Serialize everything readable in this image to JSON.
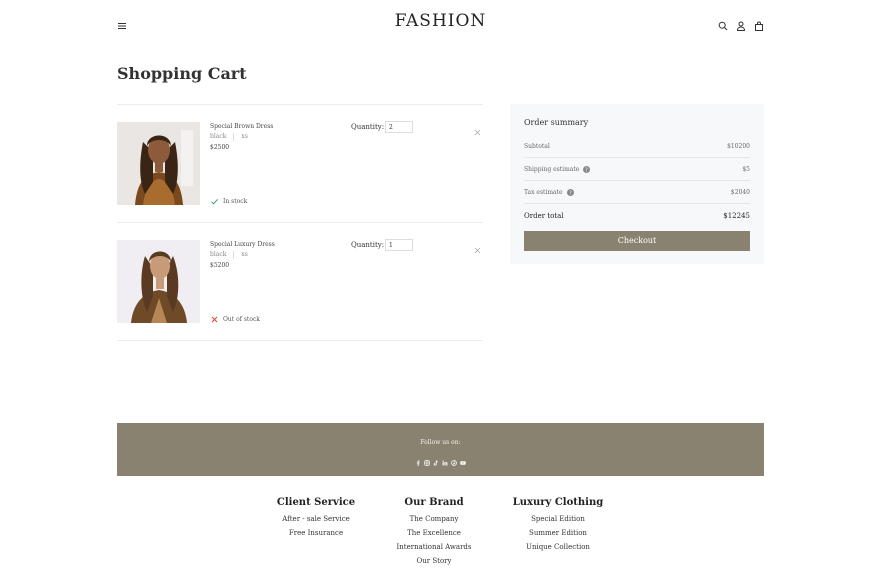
{
  "header": {
    "brand": "FASHION",
    "icons": [
      "menu-icon",
      "search-icon",
      "user-icon",
      "bag-icon"
    ]
  },
  "page_title": "Shopping Cart",
  "cart": {
    "quantity_label": "Quantity:",
    "items": [
      {
        "name": "Special Brown Dress",
        "color": "black",
        "size": "xs",
        "price": "$2500",
        "quantity": "2",
        "stock_status": "In stock",
        "stock_icon": "check-icon"
      },
      {
        "name": "Special Luxury Dress",
        "color": "black",
        "size": "xs",
        "price": "$5200",
        "quantity": "1",
        "stock_status": "Out of stock",
        "stock_icon": "x-icon"
      }
    ]
  },
  "summary": {
    "title": "Order summary",
    "subtotal_label": "Subtotal",
    "subtotal": "$10200",
    "shipping_label": "Shipping estimate",
    "shipping": "$5",
    "tax_label": "Tax estimate",
    "tax": "$2040",
    "total_label": "Order total",
    "total": "$12245",
    "checkout_label": "Checkout"
  },
  "follow": {
    "label": "Follow us on:",
    "icons": [
      "facebook-icon",
      "instagram-icon",
      "tiktok-icon",
      "linkedin-icon",
      "pinterest-icon",
      "youtube-icon"
    ]
  },
  "footer": {
    "columns": [
      {
        "title": "Client Service",
        "links": [
          "After - sale Service",
          "Free Insurance"
        ]
      },
      {
        "title": "Our Brand",
        "links": [
          "The Company",
          "The Excellence",
          "International Awards",
          "Our Story"
        ]
      },
      {
        "title": "Luxury Clothing",
        "links": [
          "Special Edition",
          "Summer Edition",
          "Unique Collection"
        ]
      }
    ]
  },
  "colors": {
    "accent": "#8a8270",
    "summary_bg": "#f7f8fa",
    "in_stock": "#3aa06b",
    "out_of_stock": "#d9453d"
  }
}
